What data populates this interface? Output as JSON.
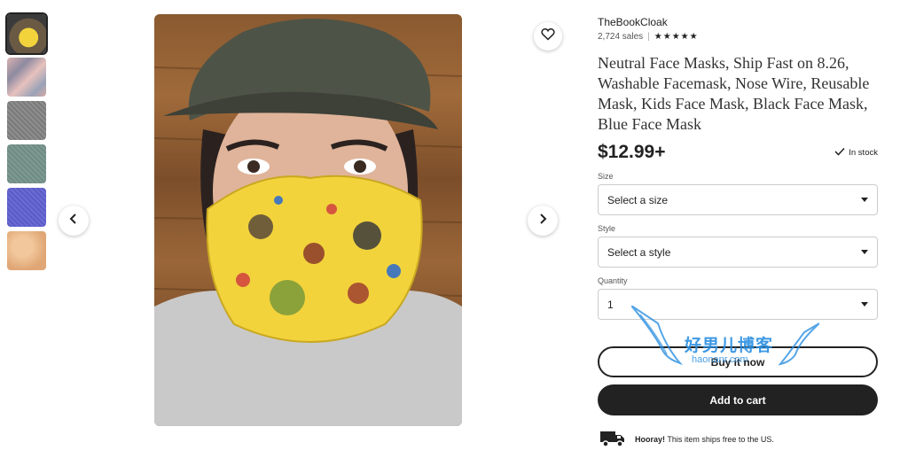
{
  "gallery": {
    "thumbnails": [
      "mask-yellow-print",
      "masks-collage",
      "fabric-gray",
      "fabric-sage",
      "fabric-blue",
      "fabric-peach"
    ],
    "active_index": 0
  },
  "icons": {
    "prev": "chevron-left-icon",
    "next": "chevron-right-icon",
    "favorite": "heart-icon",
    "stock": "check-icon",
    "shipping": "truck-icon"
  },
  "listing": {
    "shop_name": "TheBookCloak",
    "sales": "2,724 sales",
    "rating": 5,
    "title": "Neutral Face Masks, Ship Fast on 8.26, Washable Facemask, Nose Wire, Reusable Mask, Kids Face Mask, Black Face Mask, Blue Face Mask",
    "price": "$12.99+",
    "stock_status": "In stock"
  },
  "options": {
    "size": {
      "label": "Size",
      "value": "Select a size"
    },
    "style": {
      "label": "Style",
      "value": "Select a style"
    },
    "quantity": {
      "label": "Quantity",
      "value": "1"
    }
  },
  "actions": {
    "buy_now": "Buy it now",
    "add_to_cart": "Add to cart"
  },
  "shipping": {
    "highlight": "Hooray!",
    "text": "This item ships free to the US."
  },
  "watermark": {
    "text": "好男儿博客",
    "sub": "haonanr.com"
  },
  "colors": {
    "primary_dark": "#222222",
    "border": "#cccccc",
    "watermark": "#2a8fe0"
  }
}
